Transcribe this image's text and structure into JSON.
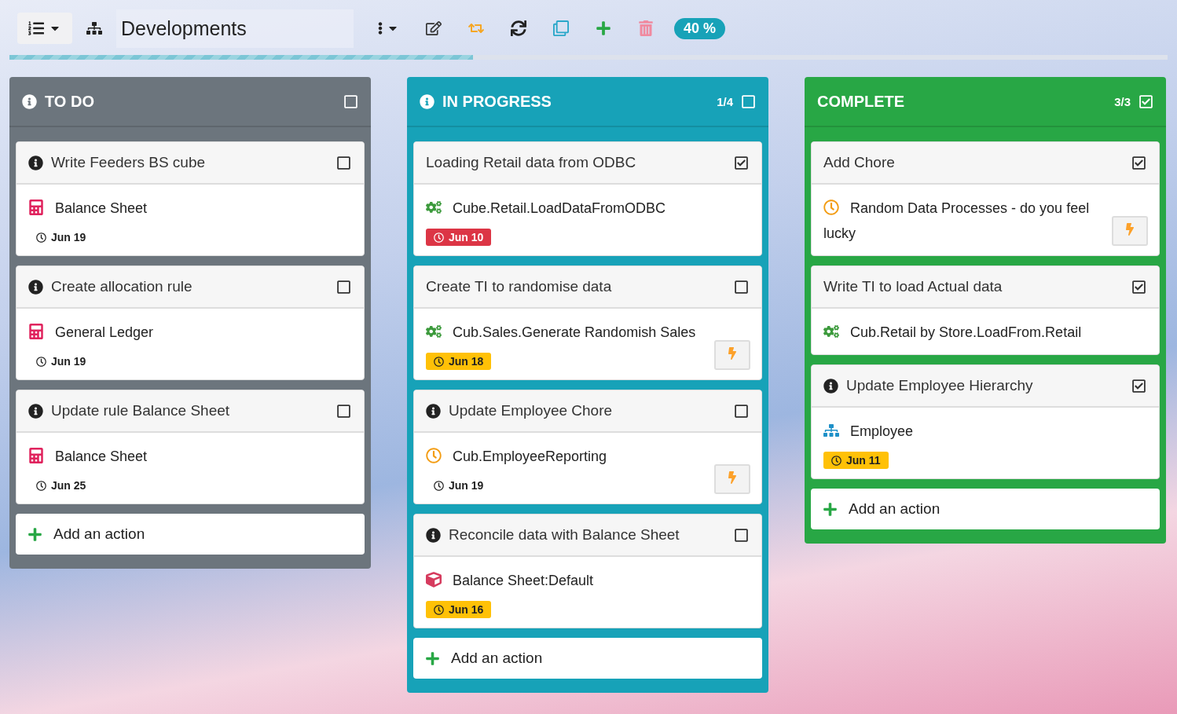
{
  "toolbar": {
    "title": "Developments",
    "badge": "40 %",
    "progress": {
      "level": 0.4
    }
  },
  "columns": [
    {
      "title": "TO DO",
      "color": "#6c757d",
      "info_icon": true,
      "checked": false,
      "cards": [
        {
          "title": "Write Feeders BS cube",
          "info_icon": true,
          "checked": false,
          "item": {
            "kind": "calc",
            "label": "Balance Sheet"
          },
          "due": {
            "text": "Jun 19"
          },
          "run_button": false
        },
        {
          "title": "Create allocation rule",
          "info_icon": true,
          "checked": false,
          "item": {
            "kind": "calc",
            "label": "General Ledger"
          },
          "due": {
            "text": "Jun 19"
          },
          "run_button": false
        },
        {
          "title": "Update rule Balance Sheet",
          "info_icon": true,
          "checked": false,
          "item": {
            "kind": "calc",
            "label": "Balance Sheet"
          },
          "due": {
            "text": "Jun 25"
          },
          "run_button": false
        }
      ],
      "add_label": "Add an action"
    },
    {
      "title": "IN PROGRESS",
      "color": "#17a2b8",
      "info_icon": true,
      "count": "1/4",
      "checked": false,
      "cards": [
        {
          "title": "Loading Retail data from ODBC",
          "info_icon": false,
          "checked": true,
          "item": {
            "kind": "process",
            "label": "Cube.Retail.LoadDataFromODBC"
          },
          "due": {
            "text": "Jun 10",
            "color": "#dc3545"
          },
          "run_button": false
        },
        {
          "title": "Create TI to randomise data",
          "info_icon": false,
          "checked": false,
          "item": {
            "kind": "process",
            "label": "Cub.Sales.Generate Randomish Sales"
          },
          "due": {
            "text": "Jun 18",
            "color": "#ffc107"
          },
          "run_button": true
        },
        {
          "title": "Update Employee Chore",
          "info_icon": true,
          "checked": false,
          "item": {
            "kind": "chore",
            "label": "Cub.EmployeeReporting"
          },
          "due": {
            "text": "Jun 19"
          },
          "run_button": true
        },
        {
          "title": "Reconcile data with Balance Sheet",
          "info_icon": true,
          "checked": false,
          "item": {
            "kind": "cube",
            "label": "Balance Sheet:Default"
          },
          "due": {
            "text": "Jun 16",
            "color": "#ffc107"
          },
          "run_button": false
        }
      ],
      "add_label": "Add an action"
    },
    {
      "title": "COMPLETE",
      "color": "#28a745",
      "info_icon": false,
      "count": "3/3",
      "checked": true,
      "cards": [
        {
          "title": "Add Chore",
          "info_icon": false,
          "checked": true,
          "item": {
            "kind": "chore",
            "label": "Random Data Processes - do you feel lucky"
          },
          "run_button": true
        },
        {
          "title": "Write TI to load Actual data",
          "info_icon": false,
          "checked": true,
          "item": {
            "kind": "process",
            "label": "Cub.Retail by Store.LoadFrom.Retail"
          },
          "run_button": false
        },
        {
          "title": "Update Employee Hierarchy",
          "info_icon": true,
          "checked": true,
          "item": {
            "kind": "dimension",
            "label": "Employee"
          },
          "due": {
            "text": "Jun 11",
            "color": "#ffc107"
          },
          "run_button": false
        }
      ],
      "add_label": "Add an action"
    }
  ]
}
